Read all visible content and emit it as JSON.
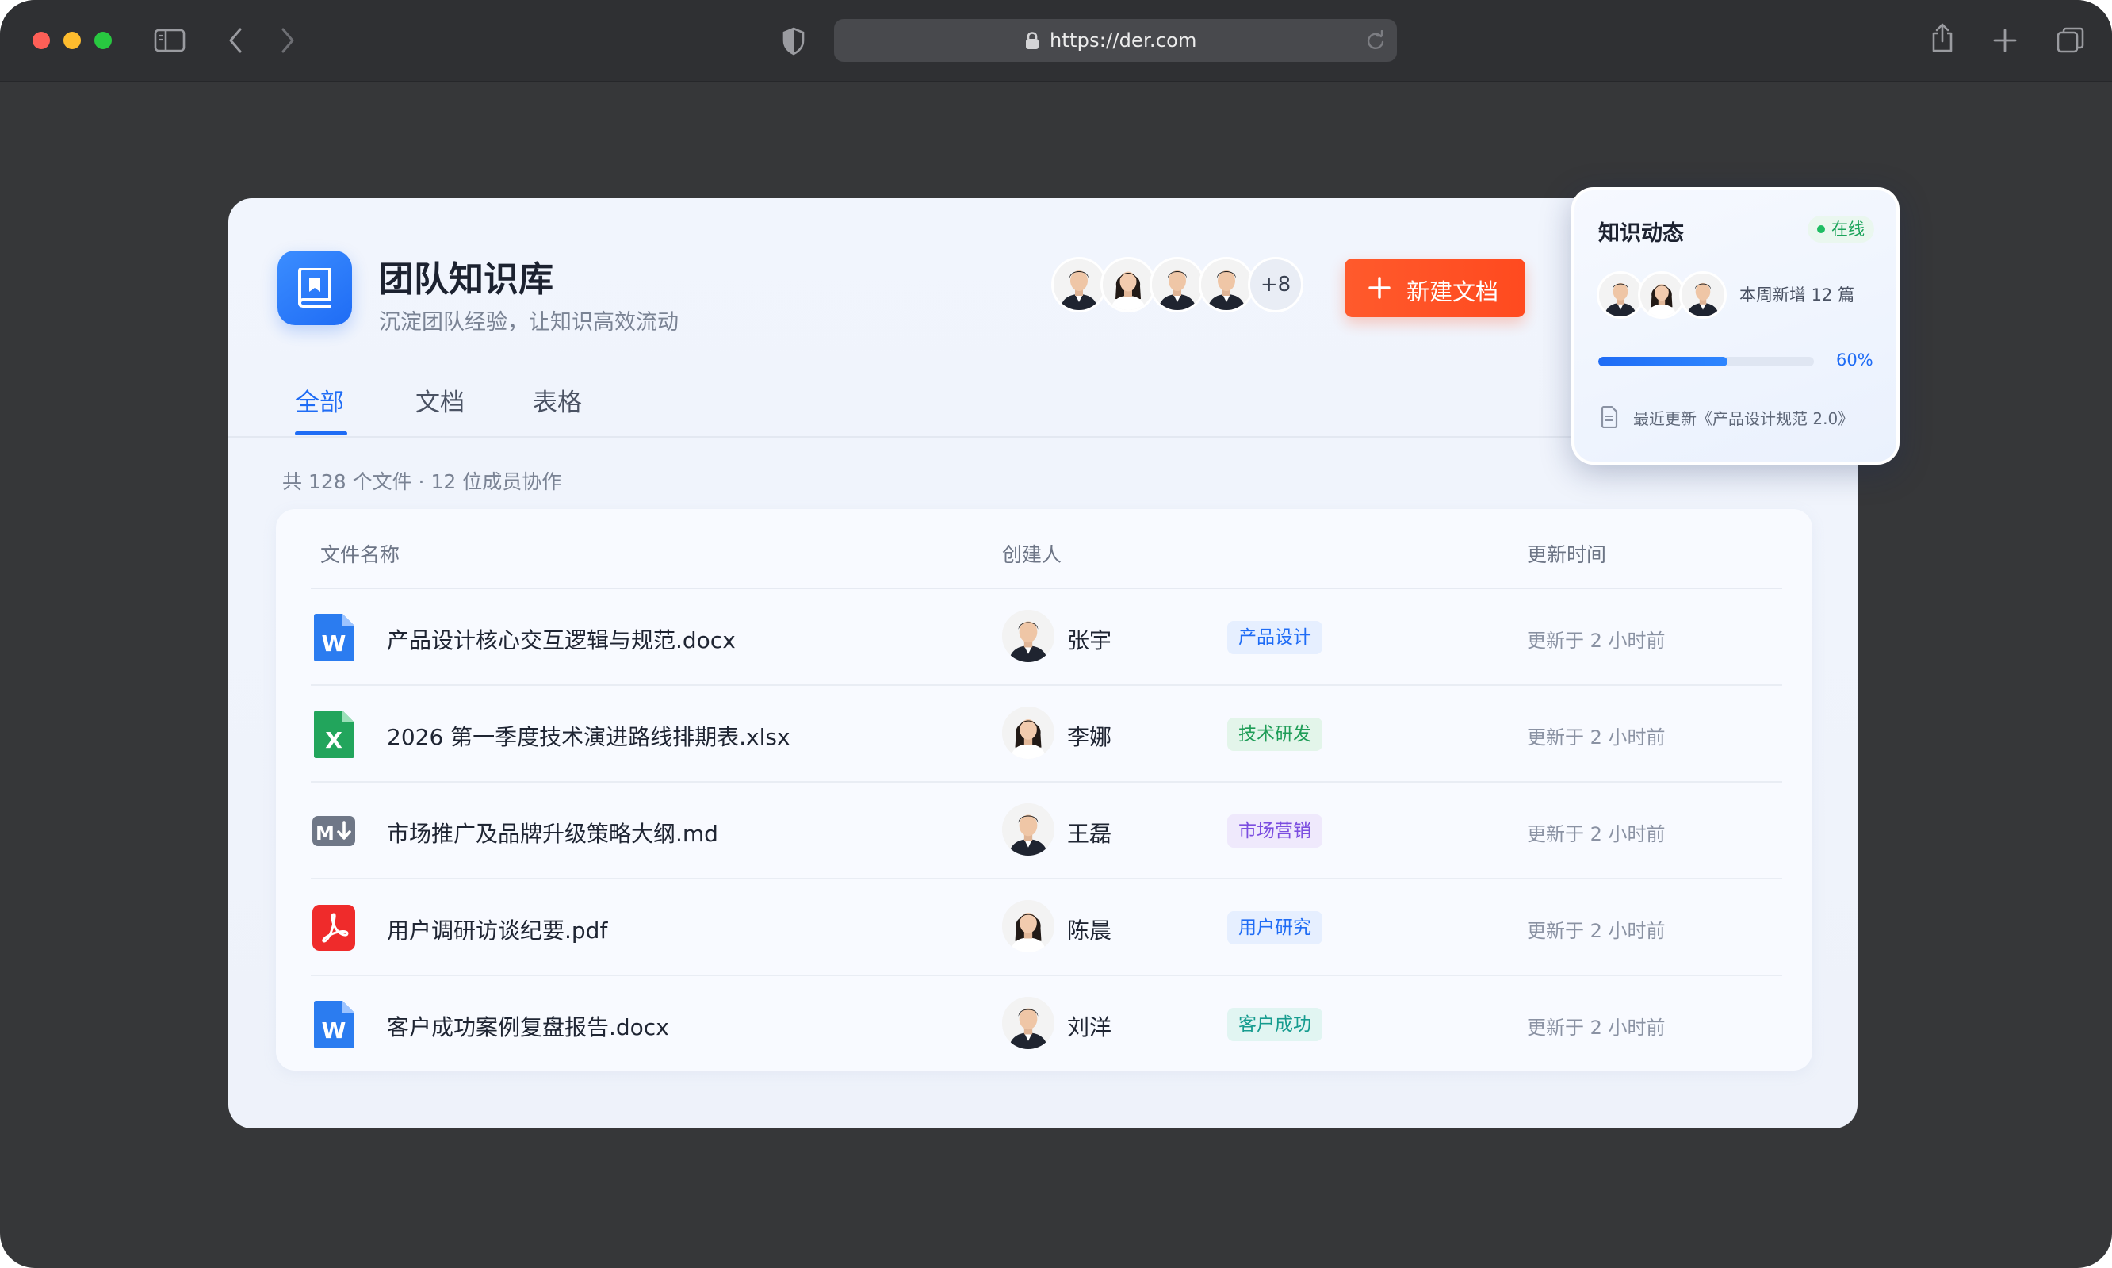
{
  "browser": {
    "url": "https://der.com"
  },
  "app": {
    "title": "团队知识库",
    "subtitle": "沉淀团队经验，让知识高效流动",
    "extra_members": "+8",
    "new_doc_label": "新建文档"
  },
  "tabs": [
    {
      "label": "全部",
      "active": true
    },
    {
      "label": "文档",
      "active": false
    },
    {
      "label": "表格",
      "active": false
    }
  ],
  "summary": "共 128 个文件 · 12 位成员协作",
  "table": {
    "headers": {
      "name": "文件名称",
      "creator": "创建人",
      "updated": "更新时间"
    },
    "rows": [
      {
        "icon": "word-doc-icon",
        "name": "产品设计核心交互逻辑与规范.docx",
        "creator": "张宇",
        "tag": "产品设计",
        "updated": "更新于 2 小时前",
        "tag_color": "#1f6cf5",
        "tag_bg": "#e6efff"
      },
      {
        "icon": "excel-sheet-icon",
        "name": "2026 第一季度技术演进路线排期表.xlsx",
        "creator": "李娜",
        "tag": "技术研发",
        "updated": "更新于 2 小时前",
        "tag_color": "#1f9d57",
        "tag_bg": "#e3f5ea"
      },
      {
        "icon": "markdown-icon",
        "name": "市场推广及品牌升级策略大纲.md",
        "creator": "王磊",
        "tag": "市场营销",
        "updated": "更新于 2 小时前",
        "tag_color": "#7b4ee0",
        "tag_bg": "#efe9fc"
      },
      {
        "icon": "pdf-icon",
        "name": "用户调研访谈纪要.pdf",
        "creator": "陈晨",
        "tag": "用户研究",
        "updated": "更新于 2 小时前",
        "tag_color": "#1f6cf5",
        "tag_bg": "#e6efff"
      },
      {
        "icon": "word-doc-icon",
        "name": "客户成功案例复盘报告.docx",
        "creator": "刘洋",
        "tag": "客户成功",
        "updated": "更新于 2 小时前",
        "tag_color": "#169c8f",
        "tag_bg": "#e1f5f2"
      }
    ]
  },
  "activity": {
    "title": "知识动态",
    "status": "在线",
    "weekly": "本周新增 12 篇",
    "progress": 0.6,
    "progress_label": "60%",
    "recent": "最近更新《产品设计规范 2.0》"
  },
  "colors": {
    "accent": "#1f6cf5",
    "cta": "#ff5226",
    "online": "#1fbd63"
  }
}
